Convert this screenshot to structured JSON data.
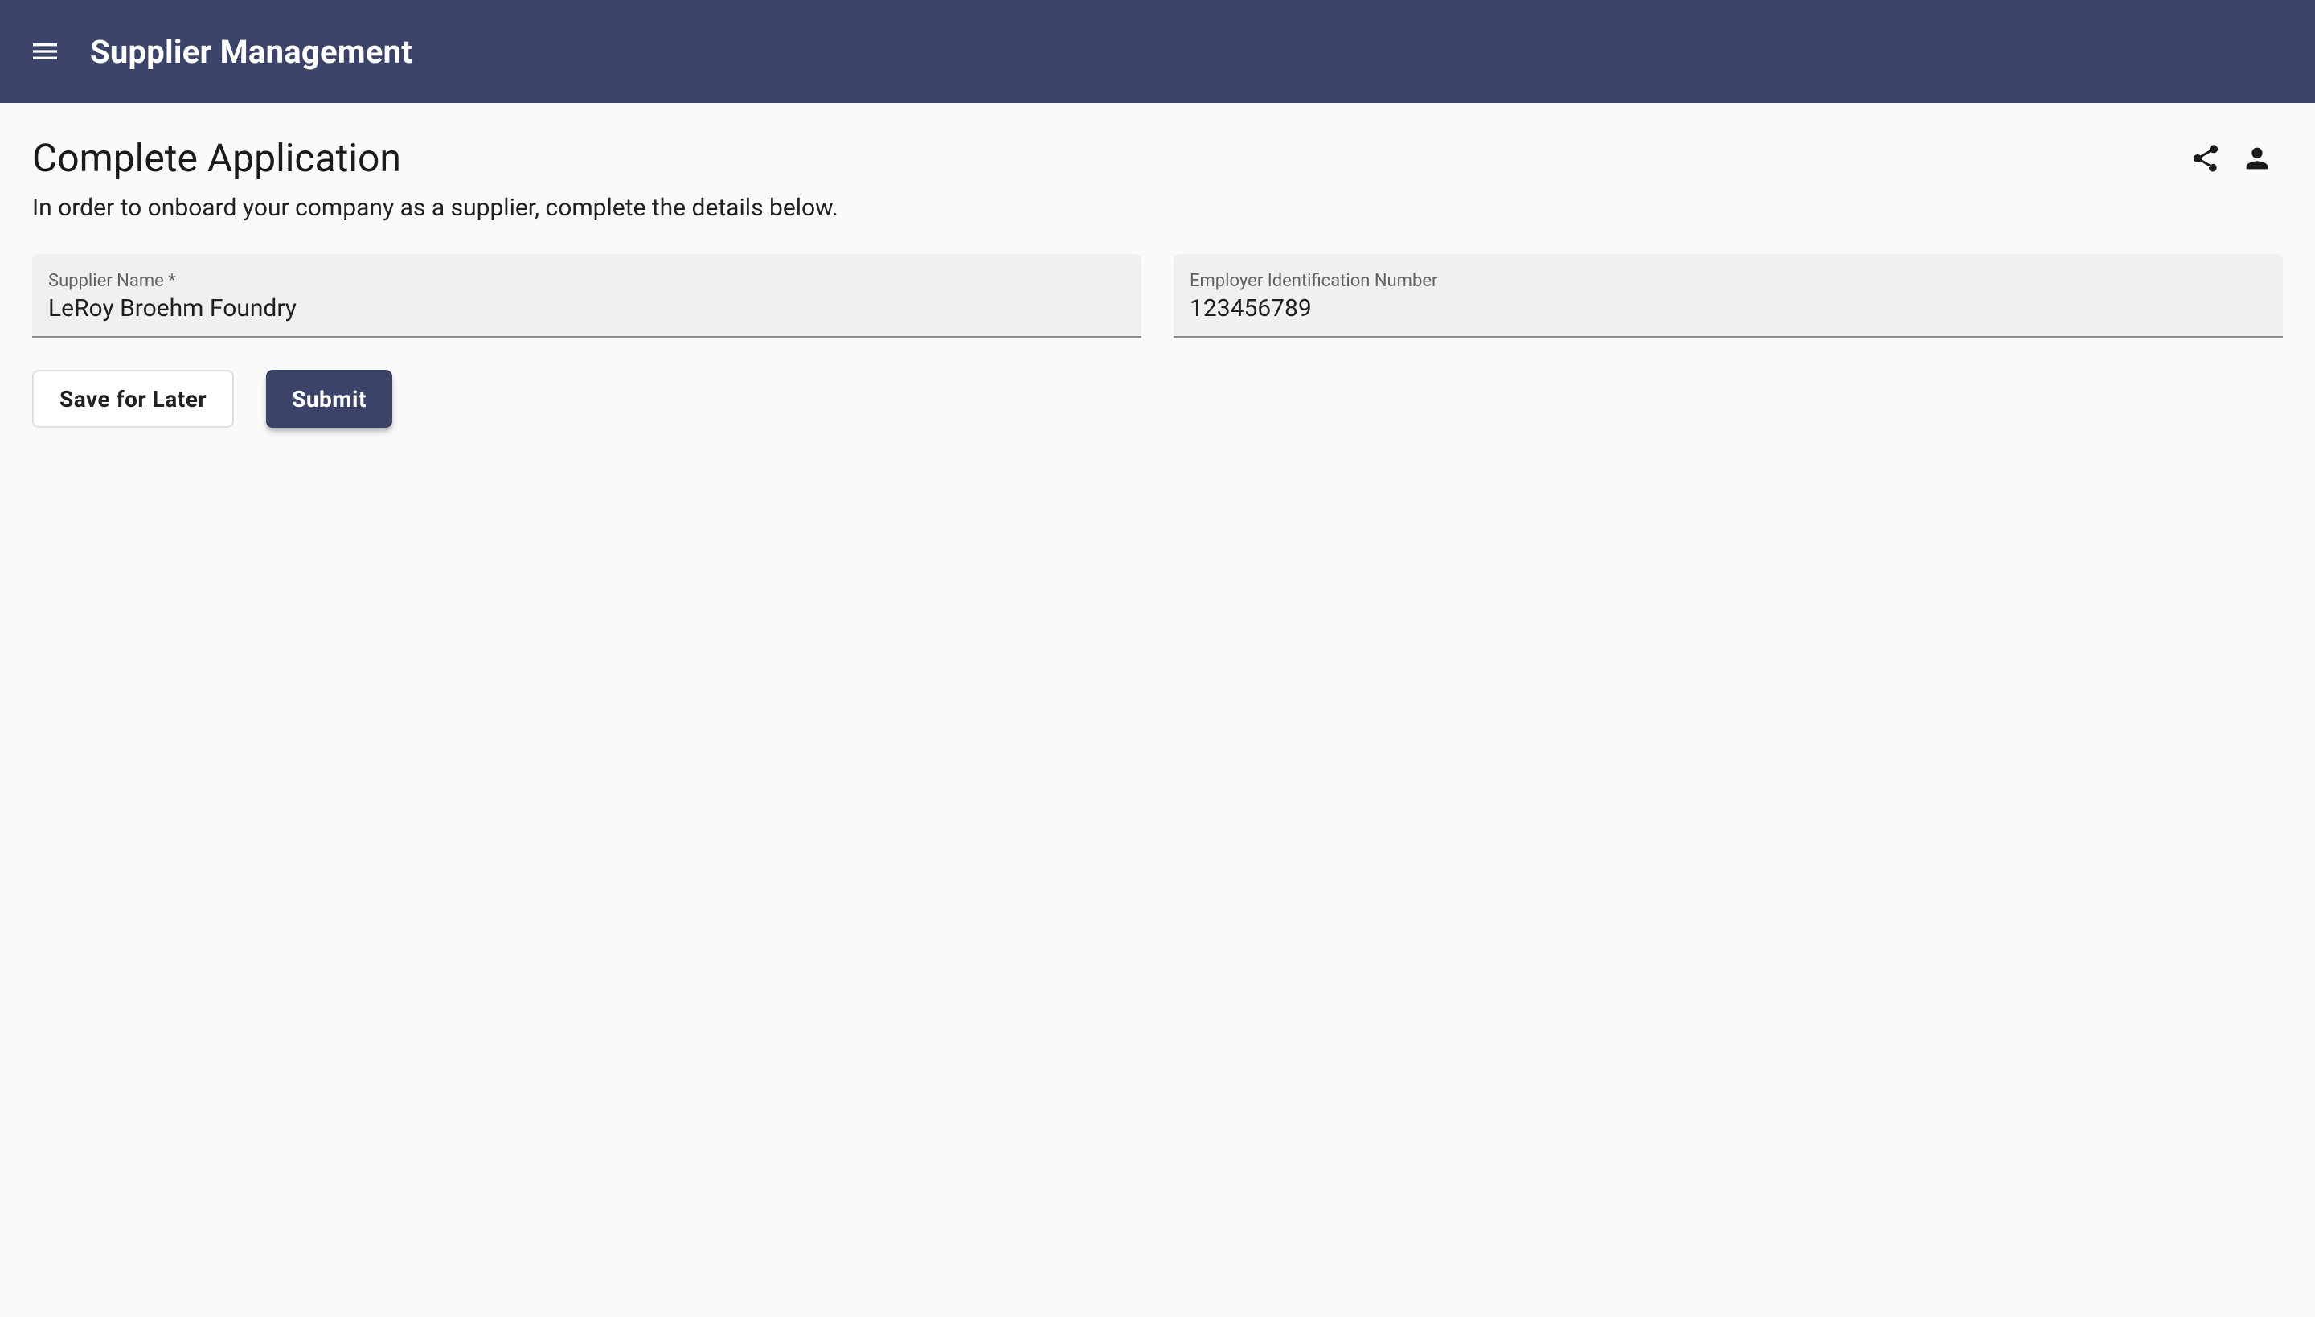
{
  "header": {
    "app_title": "Supplier Management"
  },
  "page": {
    "title": "Complete Application",
    "description": "In order to onboard your company as a supplier, complete the details below."
  },
  "form": {
    "supplier_name": {
      "label": "Supplier Name *",
      "value": "LeRoy Broehm Foundry"
    },
    "ein": {
      "label": "Employer Identification Number",
      "value": "123456789"
    }
  },
  "buttons": {
    "save_label": "Save for Later",
    "submit_label": "Submit"
  }
}
